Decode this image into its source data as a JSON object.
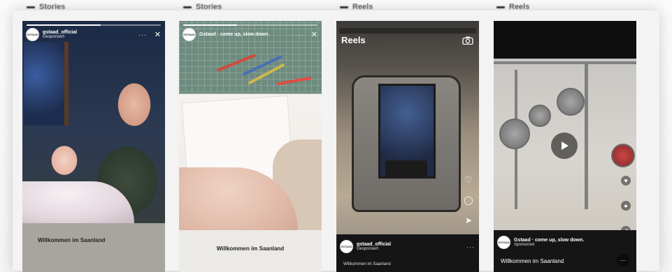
{
  "columns": [
    {
      "label": "Stories"
    },
    {
      "label": "Stories"
    },
    {
      "label": "Reels"
    },
    {
      "label": "Reels"
    }
  ],
  "cards": {
    "story1": {
      "account": "gstaad_official",
      "subtitle": "Gesponsert",
      "caption": "Willkommen im Saanland",
      "progress": 0.55
    },
    "story2": {
      "account": "Gstaad · come up, slow down.",
      "caption": "Willkommen im Saanland",
      "progress": 0.4
    },
    "reel1": {
      "title": "Reels",
      "account": "gstaad_official",
      "subtitle": "Gesponsert",
      "caption": "Willkommen im Saanland"
    },
    "reel2": {
      "account": "Gstaad · come up, slow down.",
      "subtitle": "Sponsored",
      "caption": "Willkommen im Saanland"
    }
  },
  "avatar_text": "GSTAAD",
  "icons": {
    "more": "more-dots-icon",
    "close": "close-icon",
    "camera": "camera-icon",
    "heart": "heart-icon",
    "comment": "comment-icon",
    "share": "send-icon",
    "play": "play-icon"
  },
  "colors": {
    "story_caption_bg_1": "#a8a59e",
    "story_caption_bg_2": "#eceae7",
    "reel_footer_bg": "#151515"
  }
}
